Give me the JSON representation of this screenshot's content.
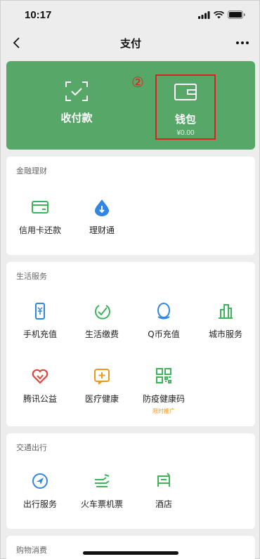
{
  "status_bar": {
    "time": "10:17"
  },
  "nav": {
    "title": "支付"
  },
  "wallet_card": {
    "collect": {
      "label": "收付款"
    },
    "wallet": {
      "label": "钱包",
      "balance": "¥0.00"
    },
    "annotation": "②"
  },
  "sections": {
    "finance": {
      "title": "金融理财",
      "items": [
        {
          "label": "信用卡还款",
          "icon": "credit-card-icon"
        },
        {
          "label": "理财通",
          "icon": "wealth-drop-icon"
        }
      ]
    },
    "life": {
      "title": "生活服务",
      "items": [
        {
          "label": "手机充值",
          "icon": "mobile-recharge-icon"
        },
        {
          "label": "生活缴费",
          "icon": "utility-payment-icon"
        },
        {
          "label": "Q币充值",
          "icon": "qq-penguin-icon"
        },
        {
          "label": "城市服务",
          "icon": "city-building-icon"
        },
        {
          "label": "腾讯公益",
          "icon": "charity-heart-icon"
        },
        {
          "label": "医疗健康",
          "icon": "medical-plus-icon"
        },
        {
          "label": "防疫健康码",
          "icon": "qr-code-icon",
          "badge": "限时推广"
        }
      ]
    },
    "travel": {
      "title": "交通出行",
      "items": [
        {
          "label": "出行服务",
          "icon": "navigation-arrow-icon"
        },
        {
          "label": "火车票机票",
          "icon": "train-plane-icon"
        },
        {
          "label": "酒店",
          "icon": "hotel-bed-icon"
        }
      ]
    },
    "shopping": {
      "title": "购物消费"
    }
  },
  "colors": {
    "green_card": "#57a868",
    "annotation_red": "#e02020",
    "icon_green": "#3fb35a",
    "icon_blue": "#2f86e6",
    "icon_red": "#e2453c",
    "icon_orange": "#f0961e",
    "badge_orange": "#f0961e"
  }
}
